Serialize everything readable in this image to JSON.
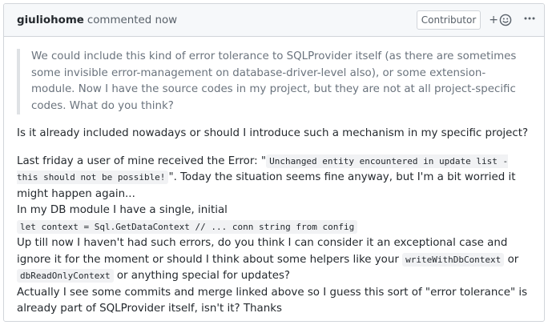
{
  "comment": {
    "author": "giuliohome",
    "action": "commented now",
    "badge": "Contributor",
    "reaction_icon": "smiley-icon",
    "more_icon": "kebab-horizontal-icon",
    "quote": "We could include this kind of error tolerance to SQLProvider itself (as there are sometimes some invisible error-management on database-driver-level also), or some extension-module. Now I have the source codes in my project, but they are not at all project-specific codes. What do you think?",
    "question": "Is it already included nowadays or should I introduce such a mechanism in my specific project?",
    "p1_a": "Last friday a user of mine received the Error: \"",
    "p1_code": "Unchanged entity encountered in update list - this should not be possible!",
    "p1_b": "\". Today the situation seems fine anyway, but I'm a bit worried it might happen again...",
    "p2": "In my DB module I have a single, initial",
    "p2_code": "let context = Sql.GetDataContext // ... conn string from config",
    "p3_a": "Up till now I haven't had such errors, do you think I can consider it an exceptional case and ignore it for the moment or should I think about some helpers like your ",
    "p3_code1": "writeWithDbContext",
    "p3_mid": " or ",
    "p3_code2": "dbReadOnlyContext",
    "p3_b": " or anything special for updates?",
    "p4": "Actually I see some commits and merge linked above so I guess this sort of \"error tolerance\" is already part of SQLProvider itself, isn't it? Thanks"
  }
}
